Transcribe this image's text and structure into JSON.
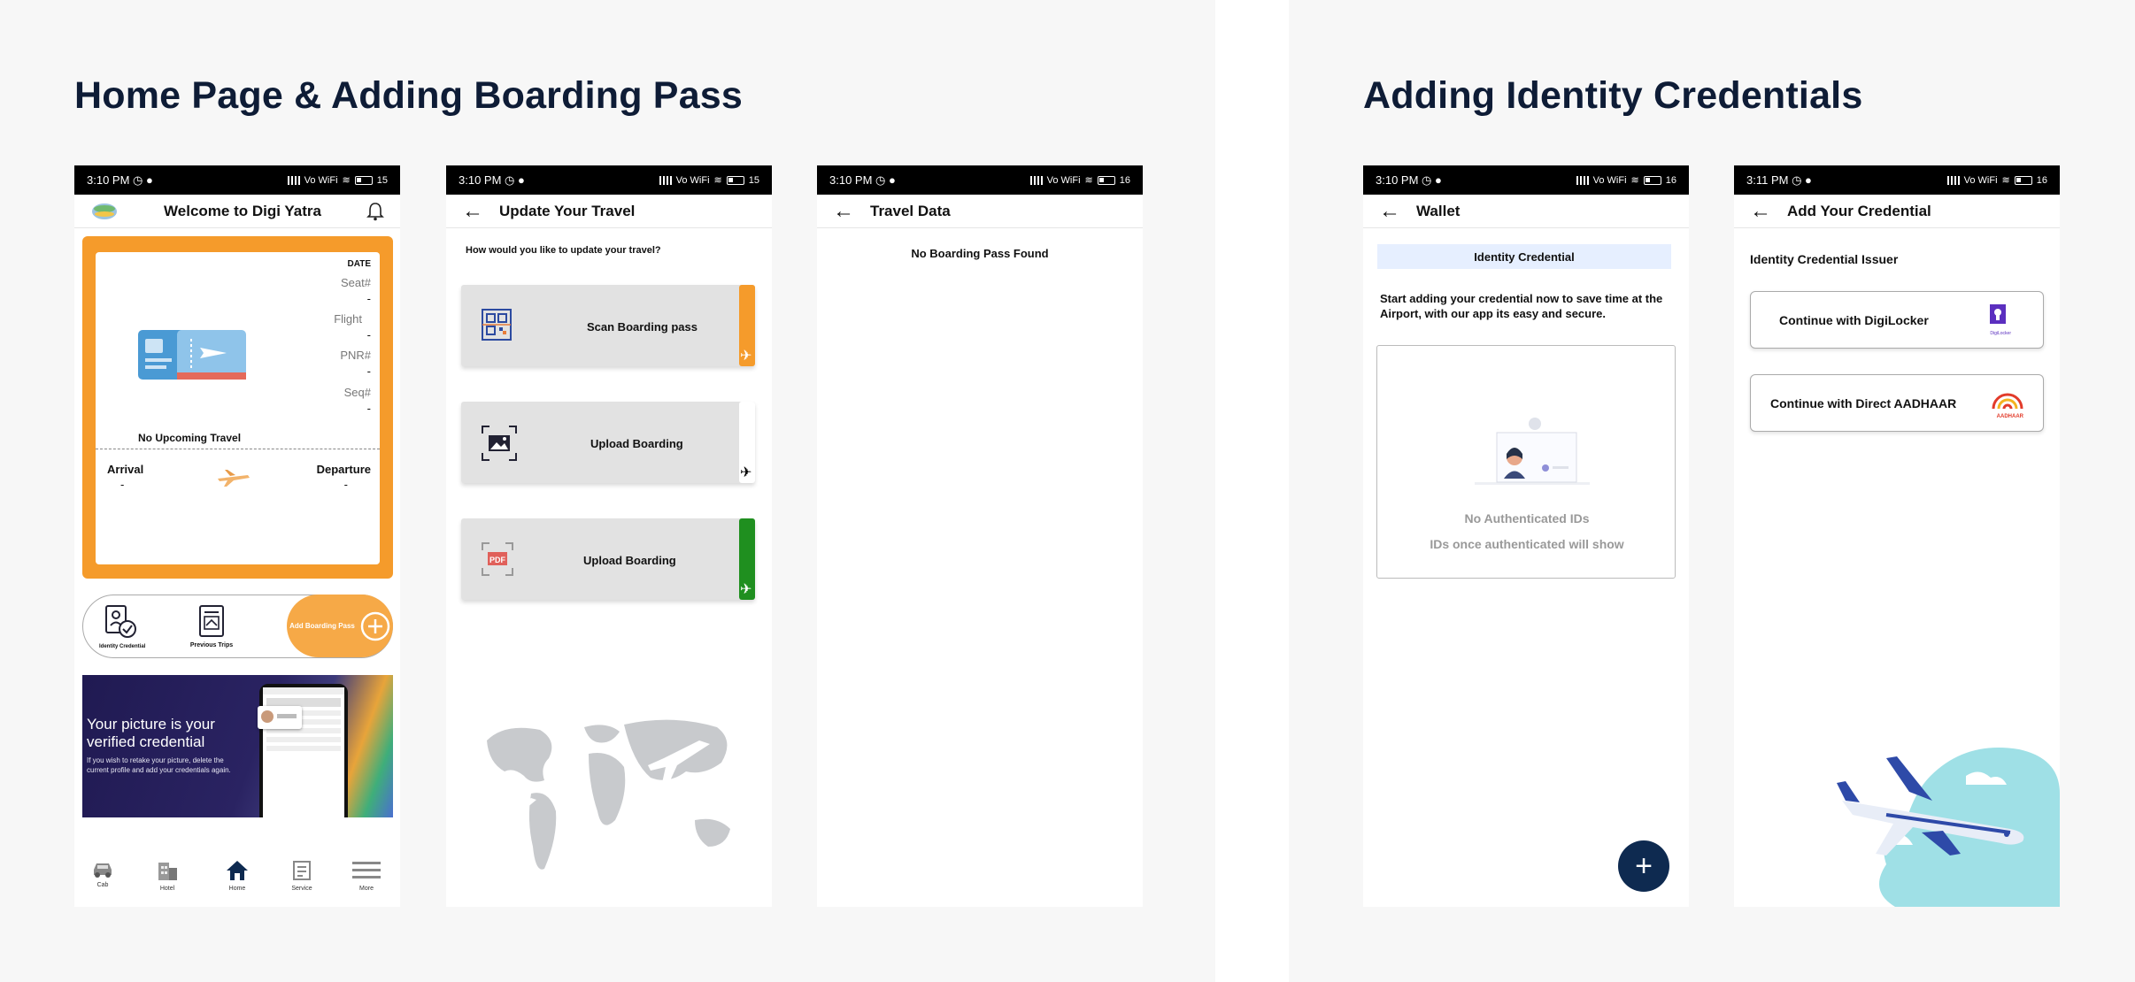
{
  "sections": {
    "left_title": "Home Page & Adding Boarding Pass",
    "right_title": "Adding Identity Credentials"
  },
  "status": {
    "time_a": "3:10 PM",
    "time_b": "3:11 PM",
    "battery_15": "15",
    "battery_16": "16",
    "net": "Vo WiFi"
  },
  "home": {
    "title": "Welcome to Digi Yatra",
    "ticket": {
      "date": "DATE",
      "seat": "Seat#",
      "flight": "Flight",
      "pnr": "PNR#",
      "seq": "Seq#",
      "dash": "-",
      "no_travel": "No Upcoming Travel",
      "arrival": "Arrival",
      "departure": "Departure"
    },
    "quick": {
      "identity": "Identity Credential",
      "trips": "Previous Trips",
      "add_pass": "Add Boarding Pass"
    },
    "banner": {
      "heading1": "Your picture is your",
      "heading2": "verified credential",
      "body1": "If you wish to retake your picture, delete the",
      "body2": "current profile and add your credentials again."
    },
    "nav": [
      "Cab",
      "Hotel",
      "Home",
      "Service",
      "More"
    ]
  },
  "update": {
    "title": "Update Your Travel",
    "question": "How would you like to update your travel?",
    "options": [
      "Scan Boarding pass",
      "Upload Boarding",
      "Upload Boarding"
    ],
    "pdf_tag": "PDF",
    "colors": [
      "#f59b2b",
      "#ffffff",
      "#1f8f1f"
    ]
  },
  "travel": {
    "title": "Travel Data",
    "empty": "No Boarding Pass Found"
  },
  "wallet": {
    "title": "Wallet",
    "tab": "Identity Credential",
    "intro1": "Start adding your credential now to save time at the",
    "intro2": "Airport, with our app its easy and secure.",
    "empty_title": "No Authenticated IDs",
    "empty_sub": "IDs once authenticated will show",
    "fab": "+"
  },
  "credential": {
    "title": "Add Your Credential",
    "issuer_label": "Identity Credential Issuer",
    "options": [
      "Continue with DigiLocker",
      "Continue with Direct AADHAAR"
    ],
    "logo_digilocker": "DigiLocker",
    "logo_aadhaar": "AADHAAR"
  },
  "colors": {
    "orange": "#f59b2b",
    "navy": "#0e2a50",
    "green": "#1f8f1f",
    "tab_bg": "#e6efff"
  }
}
